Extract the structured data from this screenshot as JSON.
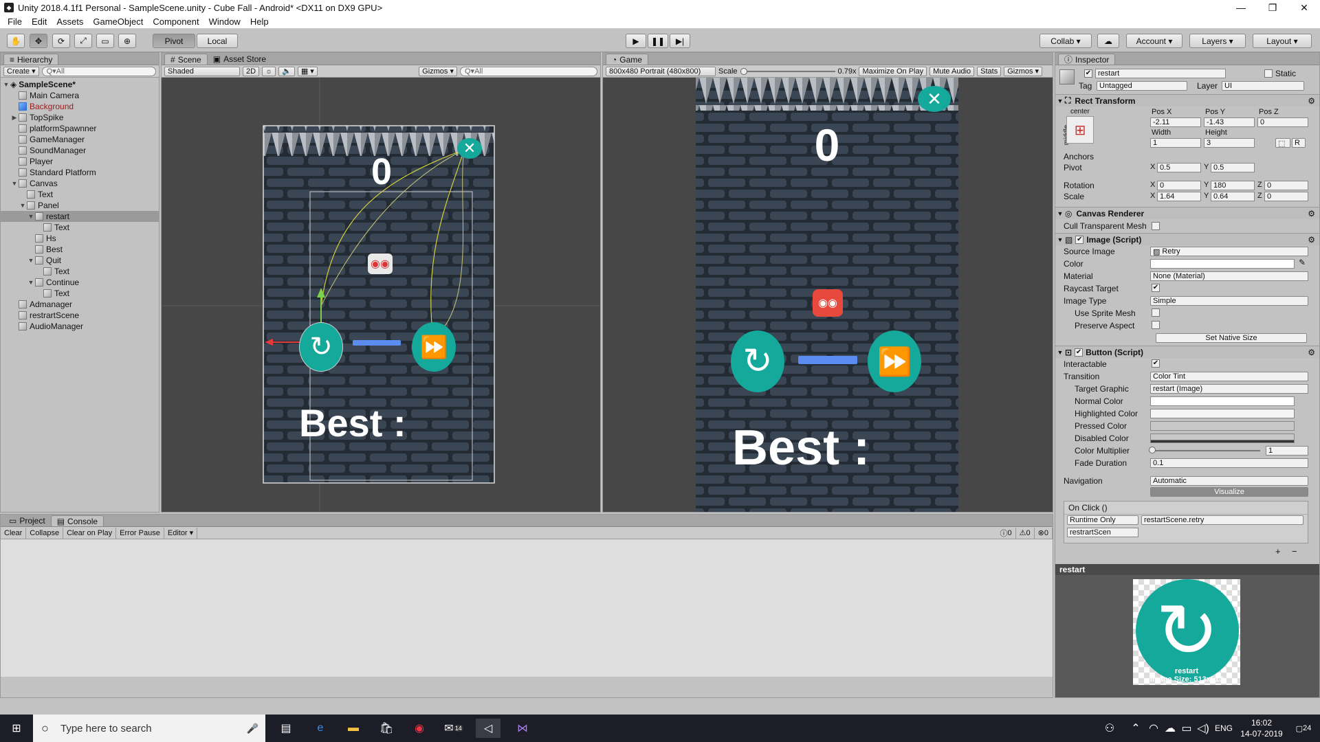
{
  "window": {
    "title": "Unity 2018.4.1f1 Personal - SampleScene.unity - Cube Fall - Android* <DX11 on DX9 GPU>",
    "minimize": "—",
    "maximize": "❐",
    "close": "✕"
  },
  "menu": [
    "File",
    "Edit",
    "Assets",
    "GameObject",
    "Component",
    "Window",
    "Help"
  ],
  "toolbar": {
    "tools": [
      "hand-icon",
      "move-icon",
      "rotate-icon",
      "scale-icon",
      "rect-icon",
      "transform-icon"
    ],
    "pivot": "Pivot",
    "local": "Local",
    "collab": "Collab ▾",
    "account": "Account",
    "layers": "Layers",
    "layout": "Layout"
  },
  "hierarchy": {
    "tab": "Hierarchy",
    "create": "Create ▾",
    "search": "Q▾All",
    "scene": "SampleScene*",
    "items": [
      {
        "label": "Main Camera",
        "depth": 1,
        "arrow": ""
      },
      {
        "label": "Background",
        "depth": 1,
        "arrow": "",
        "style": "blue red"
      },
      {
        "label": "TopSpike",
        "depth": 1,
        "arrow": "▶"
      },
      {
        "label": "platformSpawnner",
        "depth": 1,
        "arrow": ""
      },
      {
        "label": "GameManager",
        "depth": 1,
        "arrow": ""
      },
      {
        "label": "SoundManager",
        "depth": 1,
        "arrow": ""
      },
      {
        "label": "Player",
        "depth": 1,
        "arrow": ""
      },
      {
        "label": "Standard Platform",
        "depth": 1,
        "arrow": ""
      },
      {
        "label": "Canvas",
        "depth": 1,
        "arrow": "▼"
      },
      {
        "label": "Text",
        "depth": 2,
        "arrow": ""
      },
      {
        "label": "Panel",
        "depth": 2,
        "arrow": "▼"
      },
      {
        "label": "restart",
        "depth": 3,
        "arrow": "▼",
        "style": "sel"
      },
      {
        "label": "Text",
        "depth": 4,
        "arrow": ""
      },
      {
        "label": "Hs",
        "depth": 3,
        "arrow": ""
      },
      {
        "label": "Best",
        "depth": 3,
        "arrow": ""
      },
      {
        "label": "Quit",
        "depth": 3,
        "arrow": "▼"
      },
      {
        "label": "Text",
        "depth": 4,
        "arrow": ""
      },
      {
        "label": "Continue",
        "depth": 3,
        "arrow": "▼"
      },
      {
        "label": "Text",
        "depth": 4,
        "arrow": ""
      },
      {
        "label": "Admanager",
        "depth": 1,
        "arrow": ""
      },
      {
        "label": "restrartScene",
        "depth": 1,
        "arrow": ""
      },
      {
        "label": "AudioManager",
        "depth": 1,
        "arrow": ""
      }
    ]
  },
  "scene": {
    "tab": "Scene",
    "tab2": "Asset Store",
    "shading": "Shaded",
    "mode2d": "2D",
    "gizmos": "Gizmos ▾",
    "search": "Q▾All",
    "score": "0",
    "best": "Best :"
  },
  "game": {
    "tab": "Game",
    "resolution": "800x480 Portrait (480x800)",
    "scale_label": "Scale",
    "scale_value": "0.79x",
    "maximize": "Maximize On Play",
    "mute": "Mute Audio",
    "stats": "Stats",
    "gizmos": "Gizmos ▾",
    "score": "0",
    "best": "Best :"
  },
  "inspector": {
    "tab": "Inspector",
    "object_name": "restart",
    "static_label": "Static",
    "tag_label": "Tag",
    "tag": "Untagged",
    "layer_label": "Layer",
    "layer": "UI",
    "rect_transform": {
      "title": "Rect Transform",
      "center": "center",
      "middle": "middle",
      "posx_label": "Pos X",
      "posy_label": "Pos Y",
      "posz_label": "Pos Z",
      "posx": "-2.11",
      "posy": "-1.43",
      "posz": "0",
      "width_label": "Width",
      "height_label": "Height",
      "width": "1",
      "height": "3",
      "anchors": "Anchors",
      "pivot_label": "Pivot",
      "pivot_x": "0.5",
      "pivot_y": "0.5",
      "rotation_label": "Rotation",
      "rot_x": "0",
      "rot_y": "180",
      "rot_z": "0",
      "scale_label": "Scale",
      "scale_x": "1.64",
      "scale_y": "0.64",
      "scale_z": "0",
      "x": "X",
      "y": "Y",
      "z": "Z",
      "r_btn": "R"
    },
    "canvas_renderer": {
      "title": "Canvas Renderer",
      "cull": "Cull Transparent Mesh"
    },
    "image": {
      "title": "Image (Script)",
      "source_label": "Source Image",
      "source": "Retry",
      "color_label": "Color",
      "material_label": "Material",
      "material": "None (Material)",
      "raycast_label": "Raycast Target",
      "type_label": "Image Type",
      "type": "Simple",
      "sprite_mesh": "Use Sprite Mesh",
      "preserve": "Preserve Aspect",
      "native": "Set Native Size"
    },
    "button": {
      "title": "Button (Script)",
      "interactable": "Interactable",
      "transition_label": "Transition",
      "transition": "Color Tint",
      "target_label": "Target Graphic",
      "target": "restart (Image)",
      "normal": "Normal Color",
      "highlighted": "Highlighted Color",
      "pressed": "Pressed Color",
      "disabled": "Disabled Color",
      "multiplier_label": "Color Multiplier",
      "multiplier": "1",
      "fade_label": "Fade Duration",
      "fade": "0.1",
      "navigation_label": "Navigation",
      "navigation": "Automatic",
      "visualize": "Visualize",
      "onclick": "On Click ()",
      "runtime": "Runtime Only",
      "method": "restartScene.retry",
      "object": "restrartScen",
      "plus": "+",
      "minus": "−"
    },
    "preview": {
      "title": "restart",
      "label": "restart",
      "size": "Image Size: 513x513"
    }
  },
  "console": {
    "tab1": "Project",
    "tab2": "Console",
    "buttons": [
      "Clear",
      "Collapse",
      "Clear on Play",
      "Error Pause",
      "Editor ▾"
    ],
    "info": "0",
    "warn": "0",
    "err": "0"
  },
  "taskbar": {
    "search": "Type here to search",
    "time": "16:02",
    "date": "14-07-2019",
    "lang": "ENG",
    "badge": "24",
    "mail_badge": "14"
  },
  "colors": {
    "teal": "#14a99b",
    "panel": "#c2c2c2",
    "scene_bg": "#474747",
    "brick": "#2a3441"
  }
}
